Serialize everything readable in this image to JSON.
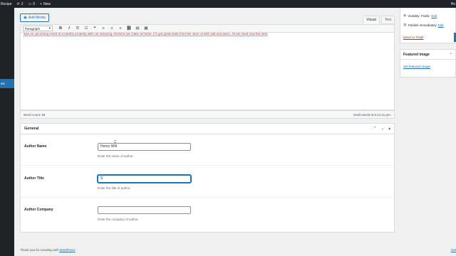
{
  "admin_bar": {
    "site_name": "Recipe",
    "updates_count": "2",
    "comments_count": "0",
    "new_label": "New",
    "right_label": "Ho"
  },
  "admin_menu": {
    "current_label": "ew"
  },
  "editor": {
    "add_media_label": "Add Media",
    "tab_visual": "Visual",
    "tab_text": "Text",
    "format_select": "Paragraph",
    "content_snippet": "was an upcoming event at a nearby property with our amazing chickens we make at home. It's got great taste from the olive oil with salt and spice. All we need now the best.",
    "word_count": "Word count: 68",
    "draft_saved": "Draft saved at 8:14:11 pm."
  },
  "metabox": {
    "title": "General",
    "fields": [
      {
        "label": "Author Name",
        "value": "Henry Wilt",
        "description": "Enter the name of author."
      },
      {
        "label": "Author Title",
        "value": "S",
        "description": "Enter the title of author."
      },
      {
        "label": "Author Company",
        "value": "",
        "description": "Enter the company of author."
      }
    ]
  },
  "sidebar": {
    "visibility_text": "Visibility: Public",
    "visibility_edit": "Edit",
    "publish_text": "Publish immediately",
    "publish_edit": "Edit",
    "trash_label": "Move to Trash",
    "featured_title": "Featured image",
    "featured_link": "Set featured image"
  },
  "footer": {
    "text": "Thank you for creating with",
    "link": "WordPress",
    "version": "Get"
  }
}
